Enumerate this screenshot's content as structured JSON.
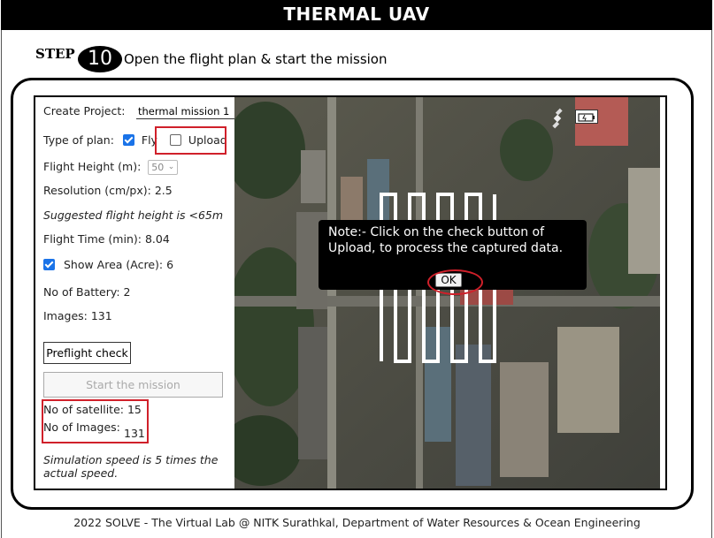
{
  "header": {
    "title": "THERMAL UAV"
  },
  "step": {
    "label": "STEP",
    "number": "10",
    "text": "Open the flight plan & start the mission"
  },
  "panel": {
    "create_project_label": "Create Project:",
    "project_name": "thermal mission 1",
    "type_of_plan_label": "Type of plan:",
    "fly_label": "Fly",
    "fly_checked": true,
    "upload_label": "Upload",
    "upload_checked": false,
    "flight_height_label": "Flight Height (m):",
    "flight_height_value": "50",
    "resolution_text": "Resolution (cm/px): 2.5",
    "suggested_text": "Suggested flight height is <65m",
    "flight_time_text": "Flight Time (min): 8.04",
    "show_area_text": "Show Area (Acre): 6",
    "show_area_checked": true,
    "battery_text": "No of Battery: 2",
    "images_text": "Images: 131",
    "preflight_button": "Preflight check",
    "start_button": "Start the mission",
    "satellite_text": "No of satellite: 15",
    "images_count_label": "No of Images:",
    "images_count_value": "131",
    "simulation_text": "Simulation speed is 5 times the actual speed."
  },
  "map": {
    "icons": [
      "satellite-icon",
      "battery-icon"
    ]
  },
  "note": {
    "text": "Note:- Click on the check button of Upload, to process the captured data.",
    "ok_button": "OK"
  },
  "footer": {
    "text": "2022 SOLVE - The Virtual Lab @ NITK Surathkal, Department of Water Resources & Ocean Engineering"
  },
  "colors": {
    "highlight": "#d0202a",
    "checkbox": "#1a73e8",
    "header_bg": "#000000"
  }
}
